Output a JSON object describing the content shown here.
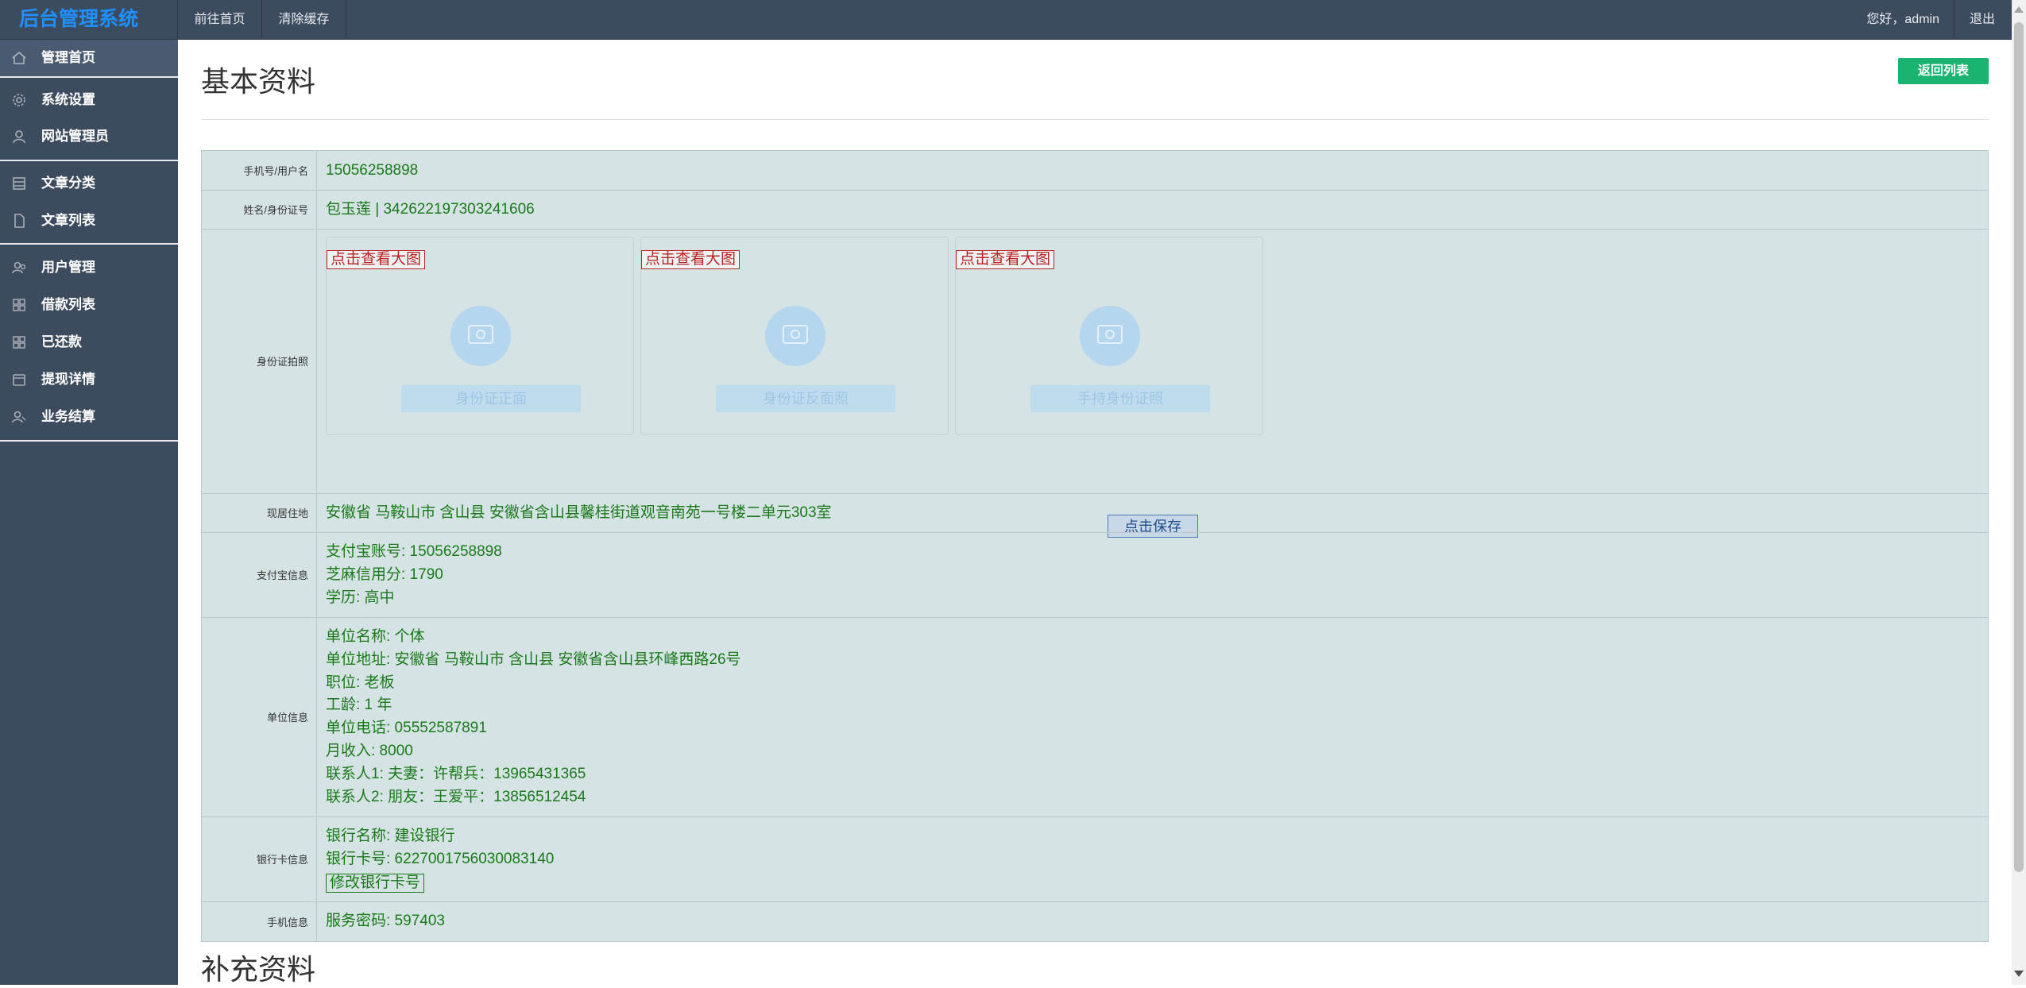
{
  "app": {
    "title": "后台管理系统"
  },
  "topnav": {
    "home_link": "前往首页",
    "clear_cache": "清除缓存",
    "greeting": "您好，admin",
    "logout": "退出"
  },
  "sidebar": {
    "items": [
      {
        "label": "管理首页",
        "icon": "home-icon"
      },
      {
        "label": "系统设置",
        "icon": "gear-icon"
      },
      {
        "label": "网站管理员",
        "icon": "user-icon"
      },
      {
        "label": "文章分类",
        "icon": "category-icon"
      },
      {
        "label": "文章列表",
        "icon": "document-icon"
      },
      {
        "label": "用户管理",
        "icon": "users-icon"
      },
      {
        "label": "借款列表",
        "icon": "grid-icon"
      },
      {
        "label": "已还款",
        "icon": "grid-icon"
      },
      {
        "label": "提现详情",
        "icon": "wallet-icon"
      },
      {
        "label": "业务结算",
        "icon": "settlement-icon"
      }
    ]
  },
  "main": {
    "title": "基本资料",
    "back_button": "返回列表",
    "supplement_title": "补充资料"
  },
  "rows": {
    "phone": {
      "label": "手机号/用户名",
      "value": "15056258898"
    },
    "identity": {
      "label": "姓名/身份证号",
      "value": "包玉莲 | 342622197303241606"
    },
    "id_photos": {
      "label": "身份证拍照",
      "view_link": "点击查看大图",
      "captions": [
        "身份证正面",
        "身份证反面照",
        "手持身份证照"
      ],
      "save_button": "点击保存"
    },
    "address": {
      "label": "现居住地",
      "value": "安徽省 马鞍山市 含山县 安徽省含山县馨桂街道观音南苑一号楼二单元303室"
    },
    "alipay": {
      "label": "支付宝信息",
      "lines": [
        "支付宝账号: 15056258898",
        "芝麻信用分: 1790",
        "学历: 高中"
      ]
    },
    "employer": {
      "label": "单位信息",
      "lines": [
        "单位名称: 个体",
        "单位地址: 安徽省 马鞍山市 含山县 安徽省含山县环峰西路26号",
        "职位: 老板",
        "工龄: 1 年",
        "单位电话: 05552587891",
        "月收入: 8000",
        "联系人1: 夫妻：许帮兵：13965431365",
        "联系人2: 朋友：王爱平：13856512454"
      ]
    },
    "bank": {
      "label": "银行卡信息",
      "lines": [
        "银行名称: 建设银行",
        "银行卡号: 6227001756030083140"
      ],
      "edit_button": "修改银行卡号"
    },
    "mobile": {
      "label": "手机信息",
      "value": "服务密码: 597403"
    }
  }
}
